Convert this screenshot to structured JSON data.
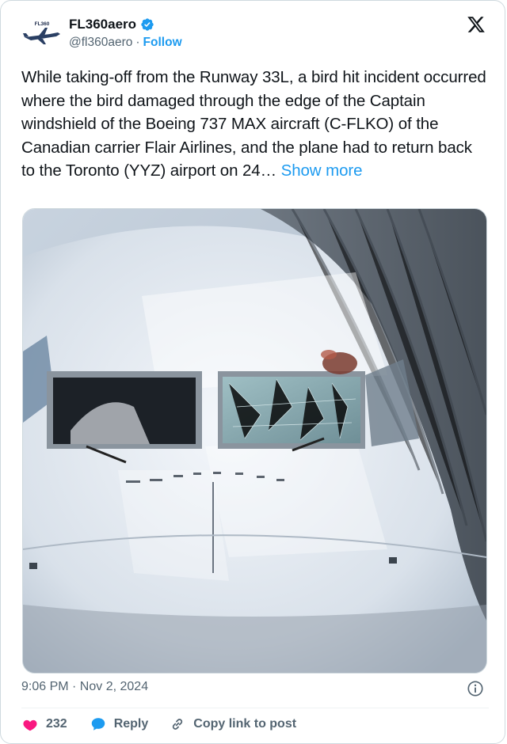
{
  "author": {
    "name": "FL360aero",
    "handle": "@fl360aero",
    "separator": "·",
    "follow_label": "Follow",
    "avatar_text": "FL360"
  },
  "tweet": {
    "text": "While taking-off from the Runway 33L, a bird hit incident occurred where the bird damaged through the edge of the Captain windshield of the Boeing 737 MAX aircraft (C-FLKO) of the Canadian carrier Flair Airlines, and the plane had to return back to the Toronto (YYZ) airport on 24…",
    "show_more_label": "Show more"
  },
  "timestamp": "9:06 PM · Nov 2, 2024",
  "actions": {
    "likes": "232",
    "reply_label": "Reply",
    "copy_link_label": "Copy link to post"
  },
  "colors": {
    "link": "#1d9bf0",
    "like": "#f91880",
    "muted": "#536471"
  },
  "icons": [
    "verified-badge-icon",
    "x-logo-icon",
    "info-icon",
    "heart-icon",
    "reply-bubble-icon",
    "link-icon"
  ]
}
